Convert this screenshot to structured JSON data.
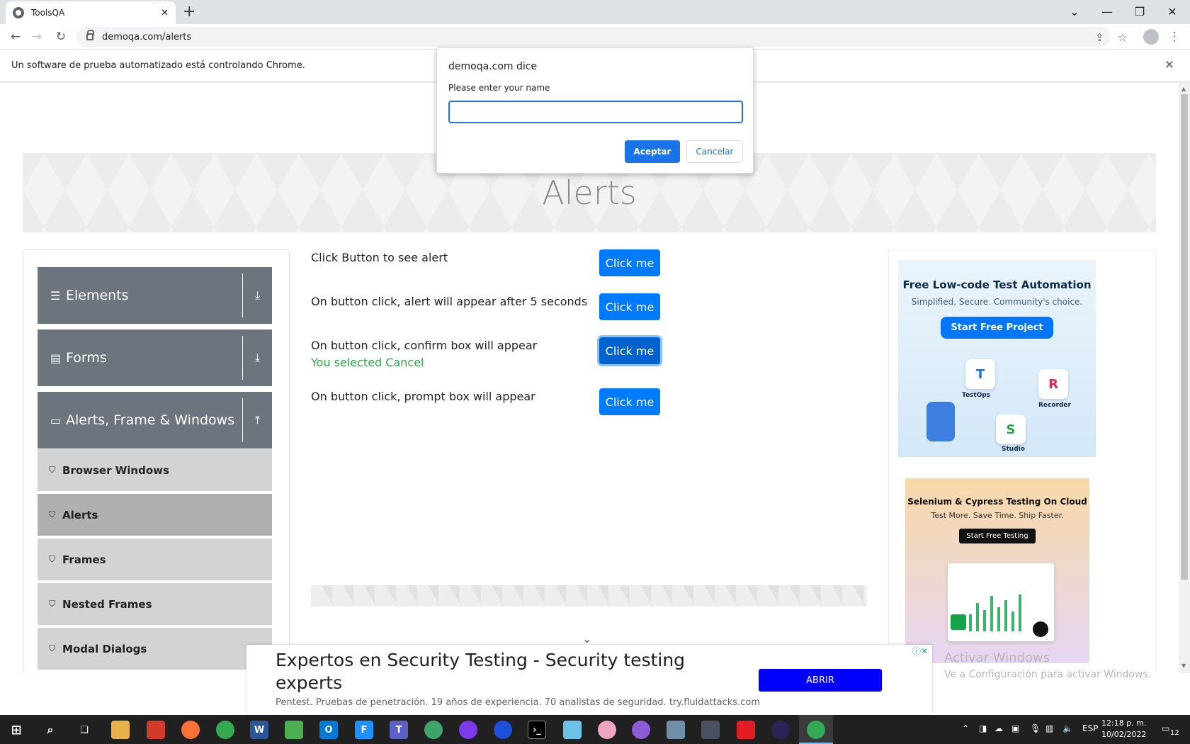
{
  "browser": {
    "tab_title": "ToolsQA",
    "tab_close": "✕",
    "new_tab": "+",
    "url": "demoqa.com/alerts",
    "infobar_text": "Un software de prueba automatizado está controlando Chrome.",
    "infobar_close": "✕"
  },
  "page": {
    "title": "Alerts",
    "sidebar": {
      "groups": [
        {
          "label": "Elements"
        },
        {
          "label": "Forms"
        },
        {
          "label": "Alerts, Frame & Windows"
        }
      ],
      "items": [
        {
          "label": "Browser Windows"
        },
        {
          "label": "Alerts"
        },
        {
          "label": "Frames"
        },
        {
          "label": "Nested Frames"
        },
        {
          "label": "Modal Dialogs"
        }
      ]
    },
    "rows": [
      {
        "label": "Click Button to see alert",
        "button": "Click me"
      },
      {
        "label": "On button click, alert will appear after 5 seconds",
        "button": "Click me"
      },
      {
        "label": "On button click, confirm box will appear",
        "result": "You selected Cancel",
        "button": "Click me"
      },
      {
        "label": "On button click, prompt box will appear",
        "button": "Click me"
      }
    ]
  },
  "ads": {
    "katalon": {
      "title": "Free Low-code Test Automation",
      "subtitle": "Simplified. Secure. Community's choice.",
      "cta": "Start Free Project",
      "tiles": [
        "TestOps",
        "Recorder",
        "Studio"
      ]
    },
    "lambdatest": {
      "title": "Selenium & Cypress Testing On Cloud",
      "subtitle": "Test More. Save Time. Ship Faster.",
      "cta": "Start Free Testing"
    },
    "bottom": {
      "title": "Expertos en Security Testing - Security testing experts",
      "subtitle": "Pentest. Pruebas de penetración. 19 años de experiencia. 70 analistas de seguridad. try.fluidattacks.com",
      "cta": "ABRIR"
    }
  },
  "watermark": {
    "line1": "Activar Windows",
    "line2": "Ve a Configuración para activar Windows."
  },
  "dialog": {
    "title": "demoqa.com dice",
    "message": "Please enter your name",
    "input_value": "",
    "ok": "Aceptar",
    "cancel": "Cancelar"
  },
  "taskbar": {
    "lang": "ESP",
    "time": "12:18 p. m.",
    "date": "10/02/2022",
    "notifications": "12"
  }
}
